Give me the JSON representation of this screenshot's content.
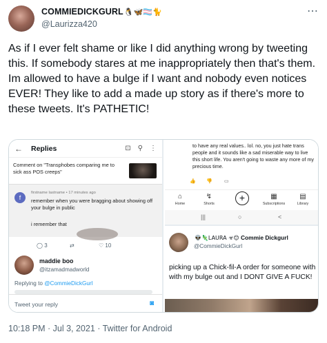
{
  "tweet": {
    "display_name": "COMMIEDICKGURL",
    "name_emojis": "🐧🦋🏳️‍⚧️🐈",
    "handle": "@Laurizza420",
    "more_icon": "⋯",
    "text": "As if I ever felt shame or like I did anything wrong by tweeting this. If somebody stares at me inappropriately then that's them. Im allowed to have a bulge if I want and nobody even notices EVER! They like to add a made up story as if there's more to these tweets. It's PATHETIC!",
    "footer": "10:18 PM · Jul 3, 2021 · Twitter for Android"
  },
  "left_screenshot": {
    "header_title": "Replies",
    "back_icon": "←",
    "cast_icon": "⊡",
    "search_icon": "⚲",
    "more_icon": "⋮",
    "comment_context": "Comment on \"Transphobes comparing me to sick ass POS creeps\"",
    "commenter_initial": "f",
    "commenter_meta": "firstname lastname • 17 minutes ago",
    "comment_text": "remember when you were bragging about showing off your bulge in public",
    "comment_text2": "i remember that",
    "reply_count": "3",
    "retweet_icon": "⇄",
    "like_count": "10",
    "reply_name": "maddie boo",
    "reply_handle": "@itzamadmadworld",
    "replying_to_label": "Replying to",
    "replying_to_handle": "@CommieDickGurl",
    "reply_placeholder": "Tweet your reply",
    "camera_icon": "◙"
  },
  "right_top_screenshot": {
    "text": "to have any real values.. lol. no, you just hate trans people and it sounds like a sad miserable way to live this short life. You aren't going to waste any more of my precious time.",
    "nav": [
      {
        "label": "Home",
        "icon": "⌂"
      },
      {
        "label": "Shorts",
        "icon": "↯"
      },
      {
        "label": "",
        "icon": "+"
      },
      {
        "label": "Subscriptions",
        "icon": "▦"
      },
      {
        "label": "Library",
        "icon": "▤"
      }
    ],
    "sys_nav": [
      "|||",
      "○",
      "<"
    ]
  },
  "right_bottom_screenshot": {
    "name_prefix": "👽🦎LAURA ☣😊",
    "name_bold": "Commie Dickgurl",
    "handle": "@CommieDickGurl",
    "text": "picking up a Chick-fil-A order for someone with with my bulge out and I DONT GIVE A FUCK!"
  }
}
